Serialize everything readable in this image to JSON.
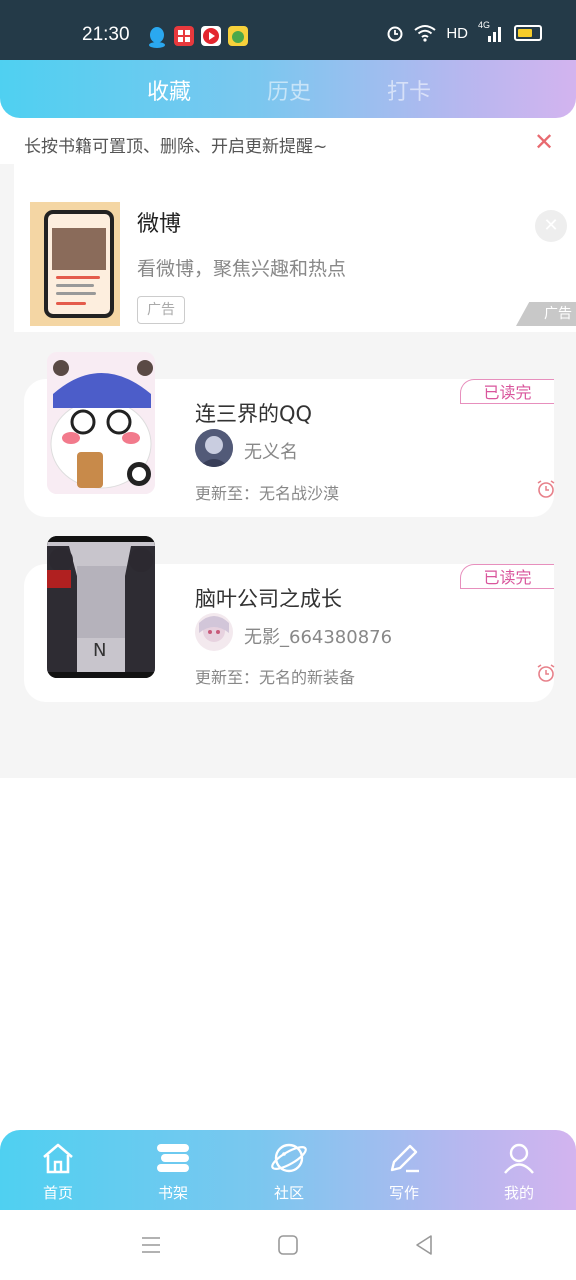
{
  "status_bar": {
    "time": "21:30",
    "network": "HD",
    "signal": "4G",
    "app_icons": [
      "qq-icon",
      "app-grid-icon",
      "video-app-icon",
      "fruit-app-icon"
    ],
    "icons": [
      "alarm-icon",
      "wifi-icon",
      "signal-icon",
      "battery-icon"
    ]
  },
  "tabs": [
    {
      "label": "收藏",
      "active": true
    },
    {
      "label": "历史",
      "active": false
    },
    {
      "label": "打卡",
      "active": false
    }
  ],
  "tip": {
    "text": "长按书籍可置顶、删除、开启更新提醒~",
    "close_icon": "close-icon"
  },
  "ad": {
    "title": "微博",
    "description": "看微博，聚焦兴趣和热点",
    "badge": "广告",
    "corner_label": "广告"
  },
  "books": [
    {
      "title": "连三界的QQ",
      "author": "无义名",
      "update": "更新至：无名战沙漠",
      "status": "已读完"
    },
    {
      "title": "脑叶公司之成长",
      "author": "无影_664380876",
      "update": "更新至：无名的新装备",
      "status": "已读完"
    }
  ],
  "bottom_nav": [
    {
      "label": "首页",
      "icon": "home-icon"
    },
    {
      "label": "书架",
      "icon": "bookshelf-icon"
    },
    {
      "label": "社区",
      "icon": "planet-icon"
    },
    {
      "label": "写作",
      "icon": "pen-icon"
    },
    {
      "label": "我的",
      "icon": "user-icon"
    }
  ],
  "colors": {
    "gradient_start": "#4fd0f1",
    "gradient_end": "#d3b4ef",
    "badge_pink": "#d9559c",
    "close_red": "#e86a70"
  }
}
